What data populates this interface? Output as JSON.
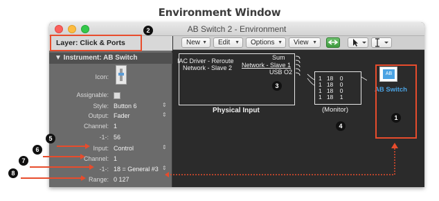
{
  "figure": {
    "heading": "Environment Window"
  },
  "window": {
    "title": "AB Switch 2 - Environment"
  },
  "inspector": {
    "layer_label": "Layer: Click & Ports",
    "instrument_label": "▼ Instrument:  AB Switch",
    "icon_label": "Icon:",
    "rows": [
      {
        "label": "Assignable:",
        "value": ""
      },
      {
        "label": "Style:",
        "value": "Button 6"
      },
      {
        "label": "Output:",
        "value": "Fader"
      },
      {
        "label": "Channel:",
        "value": "1"
      },
      {
        "label": "-1-:",
        "value": "56"
      },
      {
        "label": "Input:",
        "value": "Control"
      },
      {
        "label": "Channel:",
        "value": "1"
      },
      {
        "label": "-1-:",
        "value": "18 = General #3"
      },
      {
        "label": "Range:",
        "value": "0    127"
      }
    ]
  },
  "toolbar": {
    "new_label": "New",
    "edit_label": "Edit",
    "options_label": "Options",
    "view_label": "View",
    "link_icon": "link-icon",
    "pointer_icon": "pointer-tool-icon",
    "text_icon": "text-tool-icon"
  },
  "physical_input": {
    "title": "Physical Input",
    "ports": [
      "Sum",
      "IAC Driver - Reroute",
      "Network - Slave 1",
      "Network - Slave 2",
      "USB O2"
    ]
  },
  "monitor": {
    "title": "(Monitor)",
    "rows": [
      [
        "1",
        "18",
        "0"
      ],
      [
        "1",
        "18",
        "0"
      ],
      [
        "1",
        "18",
        "0"
      ],
      [
        "1",
        "18",
        "1"
      ]
    ]
  },
  "ab_switch": {
    "label": "AB Switch",
    "icon_label": "AB"
  },
  "callouts": [
    "1",
    "2",
    "3",
    "4",
    "5",
    "6",
    "7",
    "8"
  ],
  "colors": {
    "accent": "#e84c2c",
    "switch_label": "#4ba3e3"
  }
}
